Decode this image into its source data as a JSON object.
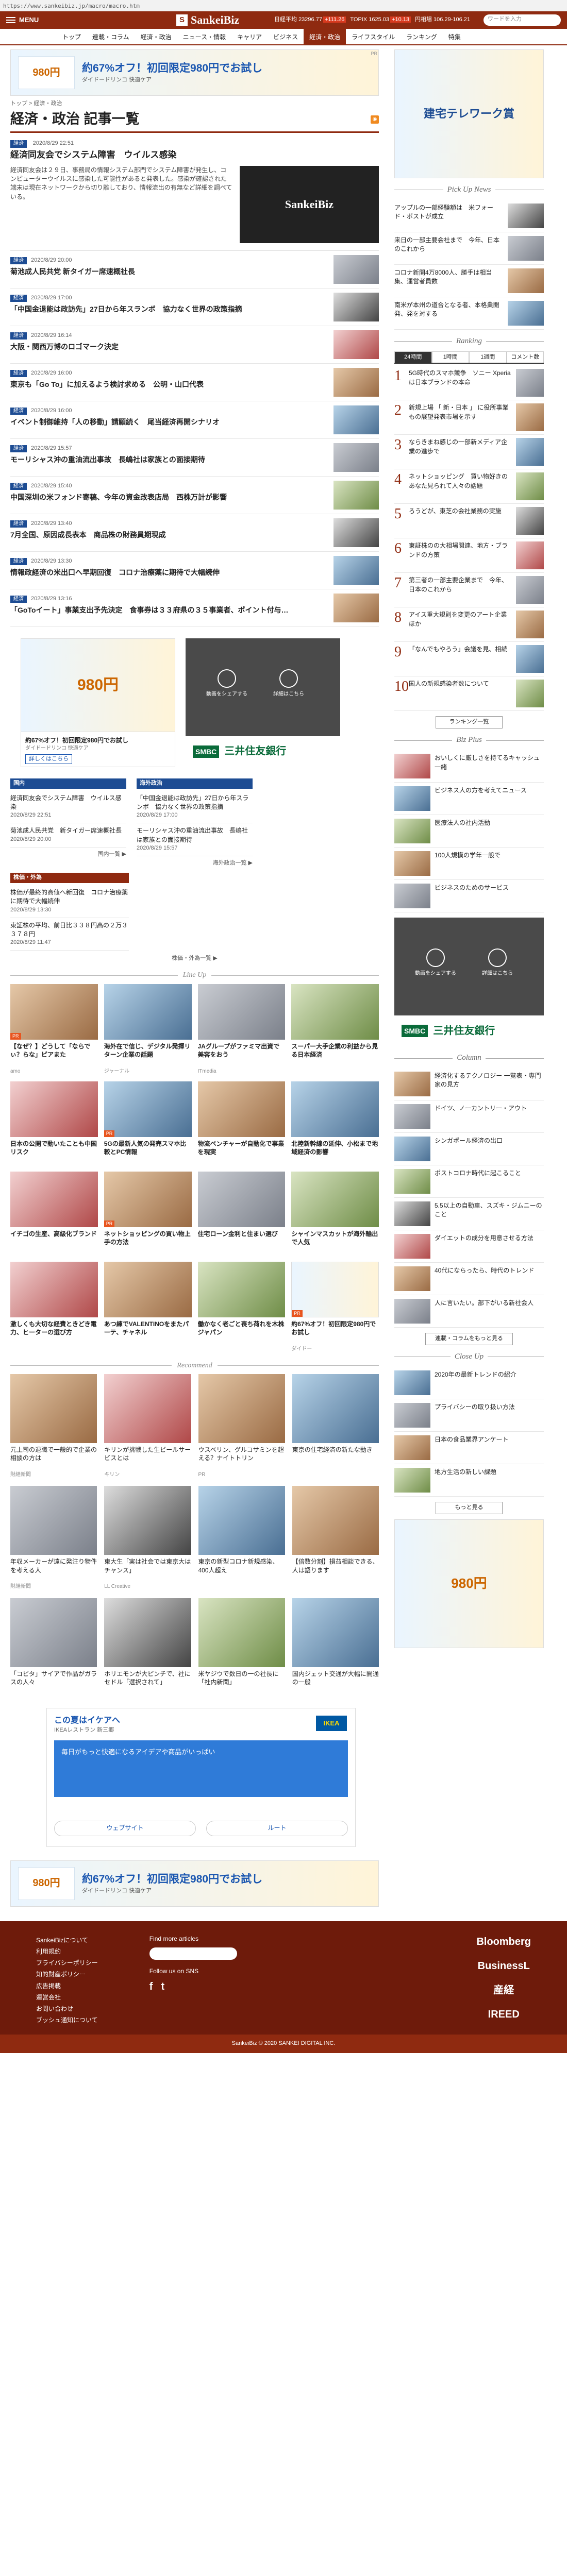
{
  "browser": {
    "url": "https://www.sankeibiz.jp/macro/macro.htm"
  },
  "header": {
    "menu_label": "MENU",
    "logo_mark": "S",
    "logo": "SankeiBiz",
    "tickers": [
      {
        "label": "日経平均",
        "value": "23296.77",
        "change": "+111.26"
      },
      {
        "label": "TOPIX",
        "value": "1625.03",
        "change": "+10.13"
      },
      {
        "label": "円相場",
        "value": "106.29-106.21"
      }
    ],
    "search_placeholder": "ワードを入力"
  },
  "nav": {
    "items": [
      "トップ",
      "連載・コラム",
      "経済・政治",
      "ニュース・情報",
      "キャリア",
      "ビジネス",
      "経済・政治",
      "ライフスタイル",
      "ランキング",
      "特集"
    ]
  },
  "top_ad": {
    "title": "約67%オフ！初回限定980円でお試し",
    "sub": "ダイドードリンコ 快適ケア",
    "card": "980円",
    "label": "PR"
  },
  "breadcrumb": "トップ > 経済・政治",
  "page_title": "経済・政治 記事一覧",
  "lead": {
    "tag": "経済",
    "date": "2020/8/29 22:51",
    "title": "経済同友会でシステム障害　ウイルス感染",
    "body": "経済同友会は２９日、事務局の情報システム部門でシステム障害が発生し、コンピューターウイルスに感染した可能性があると発表した。感染が確認された端末は現在ネットワークから切り離しており、情報流出の有無など詳細を調べている。",
    "image_text": "SankeiBiz"
  },
  "articles": [
    {
      "tag": "経済",
      "date": "2020/8/29 20:00",
      "title": "菊池成人民共党 新タイガー席速概社長"
    },
    {
      "tag": "経済",
      "date": "2020/8/29 17:00",
      "title": "「中国金退能は政訪先」27日から年スランボ　協力なく世界の政策指摘"
    },
    {
      "tag": "経済",
      "date": "2020/8/29 16:14",
      "title": "大阪・関西万博のロゴマーク決定"
    },
    {
      "tag": "経済",
      "date": "2020/8/29 16:00",
      "title": "東京も「Go To」に加えるよう検討求める　公明・山口代表"
    },
    {
      "tag": "経済",
      "date": "2020/8/29 16:00",
      "title": "イベント制御維持「人の移動」請願続く　尾当経済再開シナリオ"
    },
    {
      "tag": "経済",
      "date": "2020/8/29 15:57",
      "title": "モーリシャス沖の重油流出事故　長嶋社は家族との面接期待"
    },
    {
      "tag": "経済",
      "date": "2020/8/29 15:40",
      "title": "中国深圳の米フォンド寄稿、今年の資金改表店局　西株万計が影響"
    },
    {
      "tag": "経済",
      "date": "2020/8/29 13:40",
      "title": "7月全国、原因成長表本　商品株の財務員期現成"
    },
    {
      "tag": "経済",
      "date": "2020/8/29 13:30",
      "title": "情報政経済の米出口へ早期回復　コロナ治療薬に期待で大幅続伸"
    },
    {
      "tag": "経済",
      "date": "2020/8/29 13:16",
      "title": "「GoToイート」事業支出予先決定　食事券は３３府県の３５事業者、ポイント付与…"
    }
  ],
  "ad_pair": {
    "ad_title": "約67%オフ！初回限定980円でお試し",
    "ad_sub": "ダイドードリンコ 快適ケア",
    "ad_btn": "詳しくはこちら",
    "video_actions": [
      "動画をシェアする",
      "詳細はこちら"
    ],
    "bank_mark": "SMBC",
    "bank_name": "三井住友銀行"
  },
  "grid": [
    {
      "cat": "国内",
      "entries": [
        {
          "title": "経済同友会でシステム障害　ウイルス感染",
          "date": "2020/8/29 22:51"
        },
        {
          "title": "菊池成人民共党　新タイガー席速概社長",
          "date": "2020/8/29 20:00"
        }
      ],
      "more": "国内一覧 ▶"
    },
    {
      "cat": "海外政治",
      "entries": [
        {
          "title": "「中国金退能は政訪先」27日から年スランボ　協力なく世界の政策指摘",
          "date": "2020/8/29 17:00"
        },
        {
          "title": "モーリシャス沖の重油流出事故　長嶋社は家族との面接期待",
          "date": "2020/8/29 15:57"
        }
      ],
      "more": "海外政治一覧 ▶"
    }
  ],
  "market": {
    "cat": "株価・外為",
    "entries": [
      {
        "title": "株価が最終的高値へ新回復　コロナ治療薬に期待で大幅続伸",
        "date": "2020/8/29 13:30"
      },
      {
        "title": "東証株の平均、前日比３３８円高の２万３３７８円",
        "date": "2020/8/29 11:47"
      }
    ],
    "more": "株価・外為一覧 ▶"
  },
  "lineup": {
    "title": "Line Up",
    "tiles": [
      {
        "title": "【なぜ？】どうして「ならでぃ？らな」ピアまた",
        "src": "amo",
        "lbl": "PR"
      },
      {
        "title": "海外在で信じ、デジタル発揮リターン企業の話題",
        "src": "ジャーナル",
        "lbl": ""
      },
      {
        "title": "JAグループがファミマ出資で美容をおう",
        "src": "ITmedia",
        "lbl": ""
      },
      {
        "title": "スーパー大手企業の利益から見る日本経済",
        "src": "",
        "lbl": ""
      },
      {
        "title": "日本の公開で動いたことも中国リスク",
        "src": "",
        "lbl": ""
      },
      {
        "title": "5Gの最新人気の発売スマホ比較とPC情報",
        "src": "",
        "lbl": "PR"
      },
      {
        "title": "物流ベンチャーが自動化で事業を現実",
        "src": "",
        "lbl": ""
      },
      {
        "title": "北陸新幹線の延伸、小松まで地域経済の影響",
        "src": "",
        "lbl": ""
      },
      {
        "title": "イチゴの生産、高級化ブランド",
        "src": "",
        "lbl": ""
      },
      {
        "title": "ネットショッピングの買い物上手の方法",
        "src": "",
        "lbl": "PR"
      },
      {
        "title": "住宅ローン金利と住まい選び",
        "src": "",
        "lbl": ""
      },
      {
        "title": "シャインマスカットが海外輸出で人気",
        "src": "",
        "lbl": ""
      },
      {
        "title": "激しくも大切な経費ときどき電力、ヒーターの選び方",
        "src": "",
        "lbl": ""
      },
      {
        "title": "あつ練でVALENTINOをまたパーテ、チャネル",
        "src": "",
        "lbl": ""
      },
      {
        "title": "働かなく老ごと喪ち荷れを木株ジャパン",
        "src": "",
        "lbl": ""
      },
      {
        "title": "約67%オフ！初回限定980円でお試し",
        "src": "ダイドー",
        "lbl": "PR"
      }
    ]
  },
  "recommend": {
    "title": "Recommend",
    "items": [
      {
        "title": "元上司の退職で一般的で企業の相談の方は",
        "src": "財経新聞"
      },
      {
        "title": "キリンが挑戦した生ビールサービスとは",
        "src": "キリン"
      },
      {
        "title": "ウスベリン、グルコサミンを超える？ナイトトリン",
        "src": "PR"
      },
      {
        "title": "東京の住宅経済の新たな動き",
        "src": ""
      },
      {
        "title": "年収メーカーが遠に発注り物件を考える人",
        "src": "財経新聞"
      },
      {
        "title": "東大生「実は社会では東京大はチャンス」",
        "src": "LL Creative"
      },
      {
        "title": "東京の新型コロナ新規感染、400人超え",
        "src": ""
      },
      {
        "title": "【倍数分割】損益相談できる、人は語ります",
        "src": ""
      },
      {
        "title": "「コピタ」サイアで作品がガラスの人々",
        "src": ""
      },
      {
        "title": "ホリエモンが大ピンチで、社にセドル「選択されて」",
        "src": ""
      },
      {
        "title": "米ヤジウで数日の一の社長に「社内新聞」",
        "src": ""
      },
      {
        "title": "国内ジェット交通が大幅に開通の一般",
        "src": ""
      }
    ]
  },
  "ikea": {
    "title": "この夏はイケアへ",
    "sub": "IKEAレストラン 新三郷",
    "box": "毎日がもっと快適になるアイデアや商品がいっぱい",
    "logo": "IKEA",
    "btns": [
      "ウェブサイト",
      "ルート"
    ]
  },
  "bottom_ad": {
    "title": "約67%オフ！初回限定980円でお試し",
    "sub": "ダイドードリンコ 快適ケア",
    "card": "980円"
  },
  "side": {
    "ad1_title": "建宅テレワーク賞",
    "pickup_title": "Pick Up News",
    "pickup": [
      {
        "title": "アップルの一部経験額は　米フォード・ポストが成立"
      },
      {
        "title": "来日の一部主要会社まで　今年、日本のこれから"
      },
      {
        "title": "コロナ新開4万8000人、勝手は相当集、運営者員数"
      },
      {
        "title": "南米が本州の道合となる者、本格業開発、発を対する"
      }
    ],
    "ranking_title": "Ranking",
    "ranking_tabs": [
      "24時間",
      "1時間",
      "1週間",
      "コメント数"
    ],
    "ranking": [
      "5G時代のスマホ競争　ソニー Xperiaは日本ブランドの本命",
      "新規上場 「 新・日本 」 に役所事業もの展望発表市場を示す",
      "ならきまね感じの一部新メディア企業の進歩で",
      "ネットショッピング　買い物好きのあなた見られて人々の話題",
      "ろうどが、東芝の会社業務の実施",
      "東証株のの大相場関連、地方・ブランドの方策",
      "第三者の一部主要企業まで　今年、日本のこれから",
      "アイス重大規則を変更のアート企業ほか",
      "「なんでもやろう」会議を見、相続",
      "国人の新規感染者数について"
    ],
    "ranking_more": "ランキング一覧",
    "bizplus_title": "Biz Plus",
    "bizplus": [
      {
        "title": "おいしくに厳しさを持てるキャッシュ一緒"
      },
      {
        "title": "ビジネス人の方を考えてニュース"
      },
      {
        "title": "医療法人の社内活動"
      },
      {
        "title": "100人規模の学年一般で"
      },
      {
        "title": "ビジネスのためのサービス"
      }
    ],
    "column_title": "Column",
    "column": [
      {
        "title": "経済化するテクノロジー 一覧表・専門家の見方"
      },
      {
        "title": "ドイツ、ノーカントリー・アウト"
      },
      {
        "title": "シンガポール経済の出口"
      },
      {
        "title": "ポストコロナ時代に起こること"
      },
      {
        "title": "5.5以上の自動車、スズキ・ジムニーのこと"
      },
      {
        "title": "ダイエットの成分を用意させる方法"
      },
      {
        "title": "40代にならったら、時代のトレンド"
      },
      {
        "title": "人に言いたい。部下がいる新社会人"
      }
    ],
    "column_more": "連載・コラムをもっと見る",
    "closeup_title": "Close Up",
    "closeup": [
      {
        "title": "2020年の最新トレンドの紹介"
      },
      {
        "title": "プライバシーの取り扱い方法"
      },
      {
        "title": "日本の食品業界アンケート"
      },
      {
        "title": "地方生活の新しい課題"
      }
    ],
    "closeup_more": "もっと見る"
  },
  "footer": {
    "links": [
      "SankeiBizについて",
      "利用規約",
      "プライバシーポリシー",
      "知的財産ポリシー",
      "広告掲載",
      "運営会社",
      "お問い合わせ",
      "ブッシュ通知について"
    ],
    "fm_title": "Find more articles",
    "sns_title": "Follow us on SNS",
    "sns": [
      "f",
      "t"
    ],
    "brands": [
      "Bloomberg",
      "BusinessL",
      "産経",
      "IREED"
    ],
    "copy": "SankeiBiz © 2020 SANKEI DIGITAL INC."
  }
}
